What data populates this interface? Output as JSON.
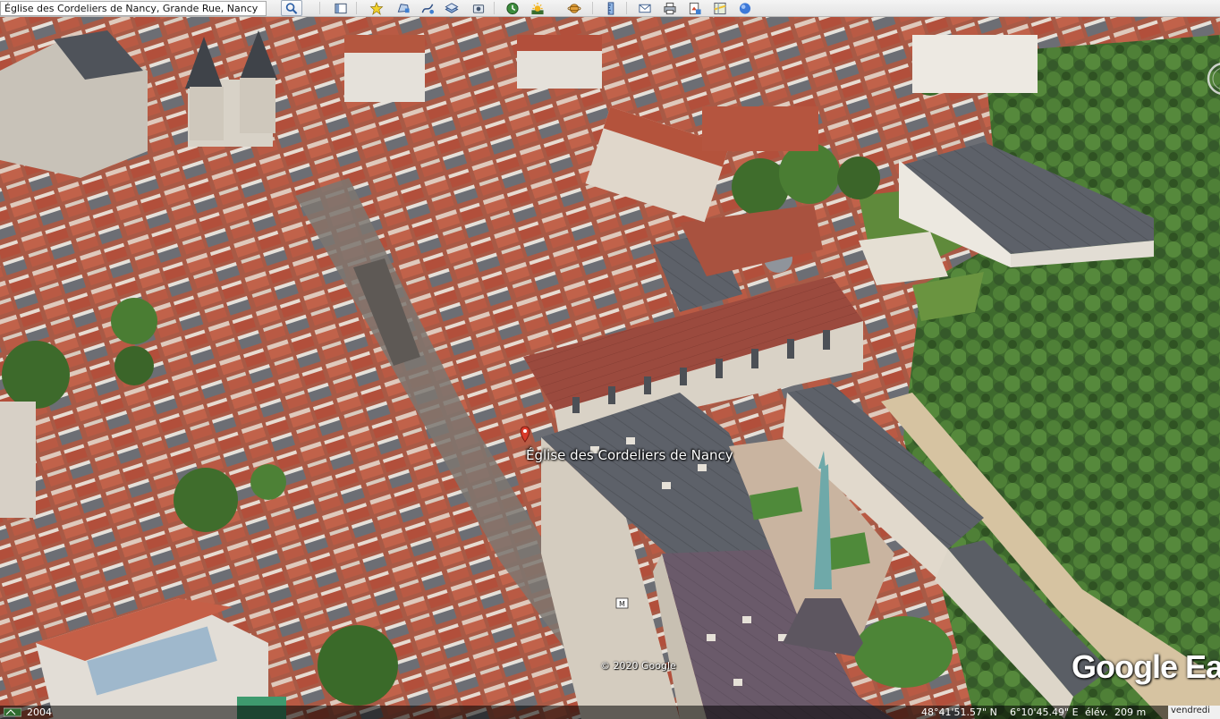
{
  "toolbar": {
    "search_value": "Église des Cordeliers de Nancy, Grande Rue, Nancy",
    "buttons": [
      {
        "name": "search-icon"
      },
      {
        "name": "sidebar-toggle-icon"
      },
      {
        "name": "placemark-icon"
      },
      {
        "name": "polygon-icon"
      },
      {
        "name": "path-icon"
      },
      {
        "name": "overlay-icon"
      },
      {
        "name": "tour-icon"
      },
      {
        "name": "historical-imagery-icon"
      },
      {
        "name": "sunlight-icon"
      },
      {
        "name": "planets-icon"
      },
      {
        "name": "ruler-icon"
      },
      {
        "name": "email-icon"
      },
      {
        "name": "print-icon"
      },
      {
        "name": "save-image-icon"
      },
      {
        "name": "maps-view-icon"
      },
      {
        "name": "earth-gallery-icon"
      }
    ]
  },
  "map": {
    "place_label": "Église des Cordeliers de Nancy",
    "copyright": "© 2020 Google",
    "logo": "Google Ea"
  },
  "status": {
    "imagery_year": "2004",
    "latitude": "48°41'51.57\" N",
    "longitude": "6°10'45.49\" E",
    "elevation_label": "élév.",
    "elevation": "209 m",
    "clock": "vendredi"
  },
  "colors": {
    "roof_red": "#b5553f",
    "slate": "#5c6068",
    "tree_green": "#3f6b2e",
    "pin_red": "#d83a2a"
  }
}
